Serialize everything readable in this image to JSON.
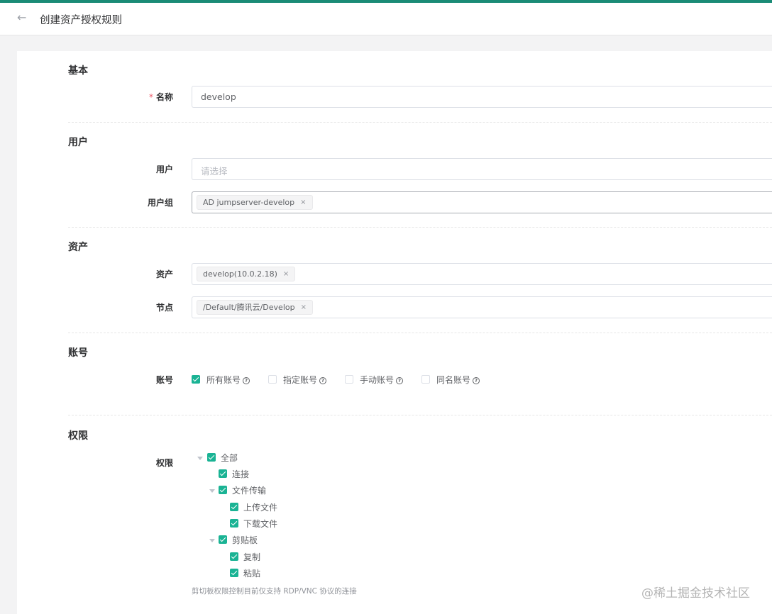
{
  "header": {
    "title": "创建资产授权规则"
  },
  "sections": {
    "basic": "基本",
    "user": "用户",
    "asset": "资产",
    "account": "账号",
    "permission": "权限"
  },
  "form": {
    "name": {
      "label": "名称",
      "required": "*",
      "value": "develop"
    },
    "users": {
      "label": "用户",
      "placeholder": "请选择"
    },
    "user_groups": {
      "label": "用户组",
      "tags": [
        "AD jumpserver-develop"
      ]
    },
    "assets": {
      "label": "资产",
      "tags": [
        "develop(10.0.2.18)"
      ]
    },
    "nodes": {
      "label": "节点",
      "tags": [
        "/Default/腾讯云/Develop"
      ]
    },
    "accounts": {
      "label": "账号",
      "options": [
        {
          "label": "所有账号",
          "checked": true
        },
        {
          "label": "指定账号",
          "checked": false
        },
        {
          "label": "手动账号",
          "checked": false
        },
        {
          "label": "同名账号",
          "checked": false
        }
      ]
    },
    "permissions": {
      "label": "权限",
      "tree": [
        {
          "label": "全部",
          "checked": true
        },
        {
          "label": "连接",
          "checked": true
        },
        {
          "label": "文件传输",
          "checked": true
        },
        {
          "label": "上传文件",
          "checked": true
        },
        {
          "label": "下载文件",
          "checked": true
        },
        {
          "label": "剪贴板",
          "checked": true
        },
        {
          "label": "复制",
          "checked": true
        },
        {
          "label": "粘贴",
          "checked": true
        }
      ],
      "hint": "剪切板权限控制目前仅支持 RDP/VNC 协议的连接"
    }
  },
  "tag_close_glyph": "×",
  "help_glyph": "?",
  "back_glyph": "←",
  "watermark": "@稀土掘金技术社区",
  "colors": {
    "accent": "#1ab394",
    "topbar": "#1a8b76",
    "required": "#ed5565"
  }
}
